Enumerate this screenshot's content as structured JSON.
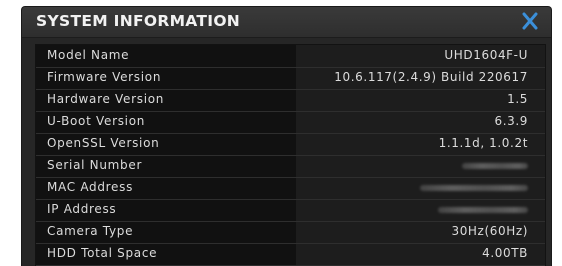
{
  "dialog": {
    "title": "SYSTEM INFORMATION",
    "close_icon": "close-x-icon",
    "accent_color": "#3b8fd9"
  },
  "rows": [
    {
      "label": "Model Name",
      "value": "UHD1604F-U"
    },
    {
      "label": "Firmware Version",
      "value": "10.6.117(2.4.9) Build 220617"
    },
    {
      "label": "Hardware Version",
      "value": "1.5"
    },
    {
      "label": "U-Boot Version",
      "value": "6.3.9"
    },
    {
      "label": "OpenSSL Version",
      "value": "1.1.1d, 1.0.2t"
    },
    {
      "label": "Serial Number",
      "value": ""
    },
    {
      "label": "MAC Address",
      "value": ""
    },
    {
      "label": "IP Address",
      "value": ""
    },
    {
      "label": "Camera Type",
      "value": "30Hz(60Hz)"
    },
    {
      "label": "HDD Total Space",
      "value": "4.00TB"
    }
  ]
}
